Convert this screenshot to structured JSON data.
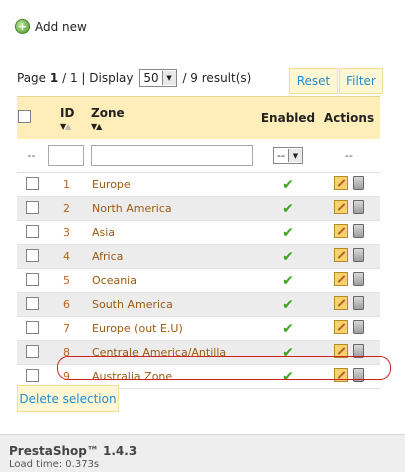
{
  "actions": {
    "add_new": "Add new"
  },
  "pagination": {
    "page_label": "Page",
    "page_current": "1",
    "page_sep": "/",
    "page_total": "1",
    "display_label": "| Display",
    "per_page": "50",
    "results": "/ 9 result(s)"
  },
  "buttons": {
    "reset": "Reset",
    "filter": "Filter",
    "delete_selection": "Delete selection"
  },
  "table": {
    "headers": {
      "id": "ID",
      "zone": "Zone",
      "enabled": "Enabled",
      "actions": "Actions"
    },
    "filter": {
      "dash": "--",
      "enabled_value": "--",
      "id_value": "",
      "zone_value": ""
    },
    "rows": [
      {
        "id": "1",
        "zone": "Europe",
        "enabled": true
      },
      {
        "id": "2",
        "zone": "North America",
        "enabled": true
      },
      {
        "id": "3",
        "zone": "Asia",
        "enabled": true
      },
      {
        "id": "4",
        "zone": "Africa",
        "enabled": true
      },
      {
        "id": "5",
        "zone": "Oceania",
        "enabled": true
      },
      {
        "id": "6",
        "zone": "South America",
        "enabled": true
      },
      {
        "id": "7",
        "zone": "Europe (out E.U)",
        "enabled": true
      },
      {
        "id": "8",
        "zone": "Centrale America/Antilla",
        "enabled": true
      },
      {
        "id": "9",
        "zone": "Australia Zone",
        "enabled": true
      }
    ]
  },
  "footer": {
    "brand": "PrestaShop™ 1.4.3",
    "load_time": "Load time: 0.373s"
  },
  "icons": {
    "enabled": "check-icon",
    "edit": "edit-icon",
    "delete": "trash-icon",
    "add": "plus-icon"
  },
  "colors": {
    "header_bg": "#ffeeb9",
    "button_bg": "#fff6d3",
    "link": "#268ccd",
    "highlight": "#cc2222"
  }
}
